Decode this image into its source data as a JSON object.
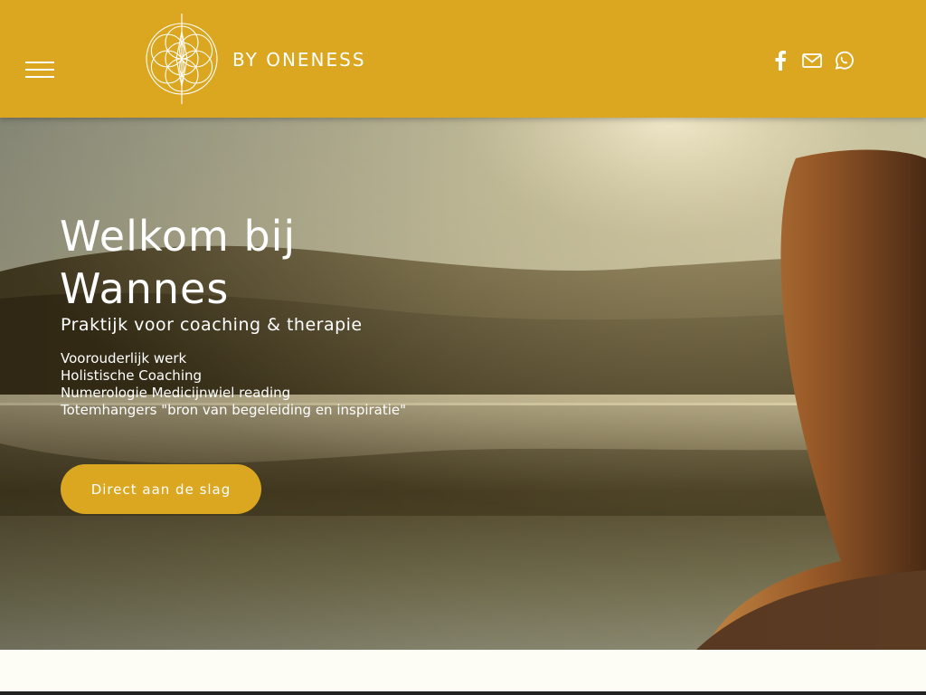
{
  "header": {
    "brand": "BY ONENESS",
    "menu_icon": "hamburger-menu-icon",
    "logo_icon": "flower-of-life-icon",
    "socials": [
      {
        "name": "facebook",
        "icon": "facebook-icon"
      },
      {
        "name": "email",
        "icon": "mail-icon"
      },
      {
        "name": "whatsapp",
        "icon": "whatsapp-icon"
      }
    ]
  },
  "hero": {
    "title_line1": "Welkom bij",
    "title_line2": "Wannes",
    "subtitle": "Praktijk voor coaching & therapie",
    "services": [
      "Voorouderlijk werk",
      "Holistische Coaching",
      "Numerologie Medicijnwiel reading",
      "Totemhangers \"bron van begeleiding en inspiratie\""
    ],
    "cta_label": "Direct aan de slag"
  },
  "colors": {
    "accent": "#dba721",
    "text": "#ffffff",
    "page_background": "#fdfdf5"
  }
}
